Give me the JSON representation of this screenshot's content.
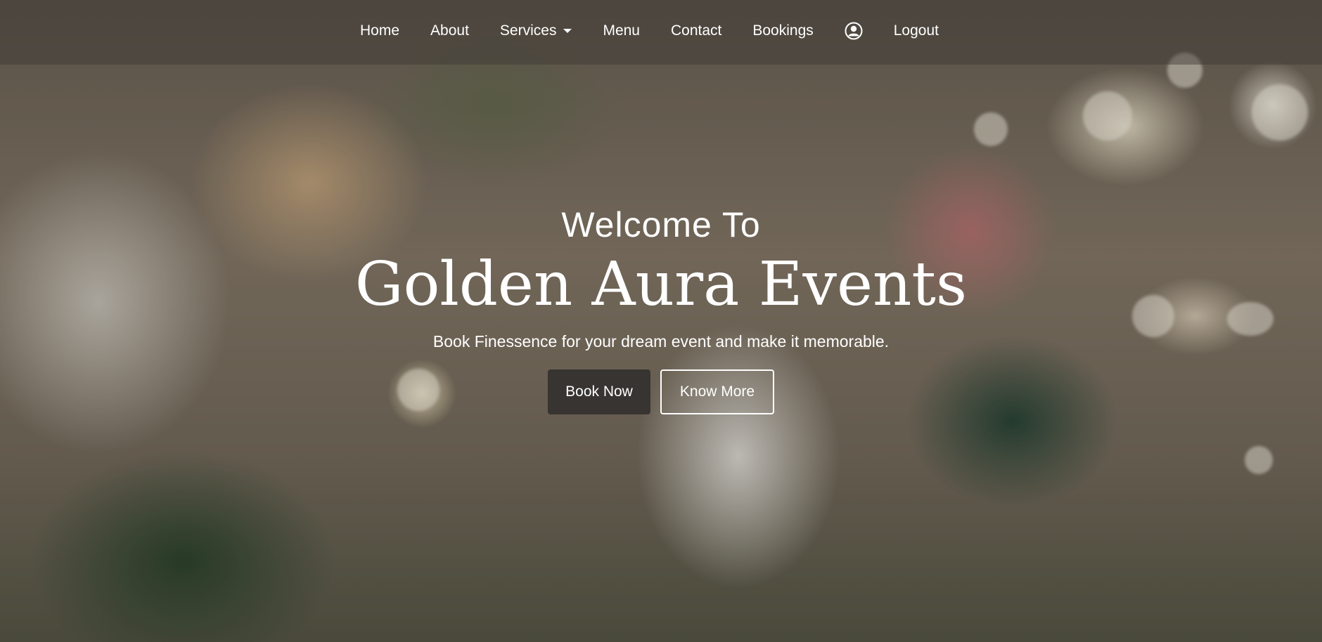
{
  "nav": {
    "items": [
      {
        "label": "Home"
      },
      {
        "label": "About"
      },
      {
        "label": "Services"
      },
      {
        "label": "Menu"
      },
      {
        "label": "Contact"
      },
      {
        "label": "Bookings"
      }
    ],
    "user_icon": "user-circle-icon",
    "logout_label": "Logout"
  },
  "hero": {
    "welcome": "Welcome To",
    "brand": "Golden Aura Events",
    "tagline": "Book Finessence for your dream event and make it memorable.",
    "primary_button": "Book Now",
    "secondary_button": "Know More"
  },
  "colors": {
    "text": "#ffffff",
    "navbar_bg": "#3c3732",
    "primary_button_bg": "#32302e"
  }
}
